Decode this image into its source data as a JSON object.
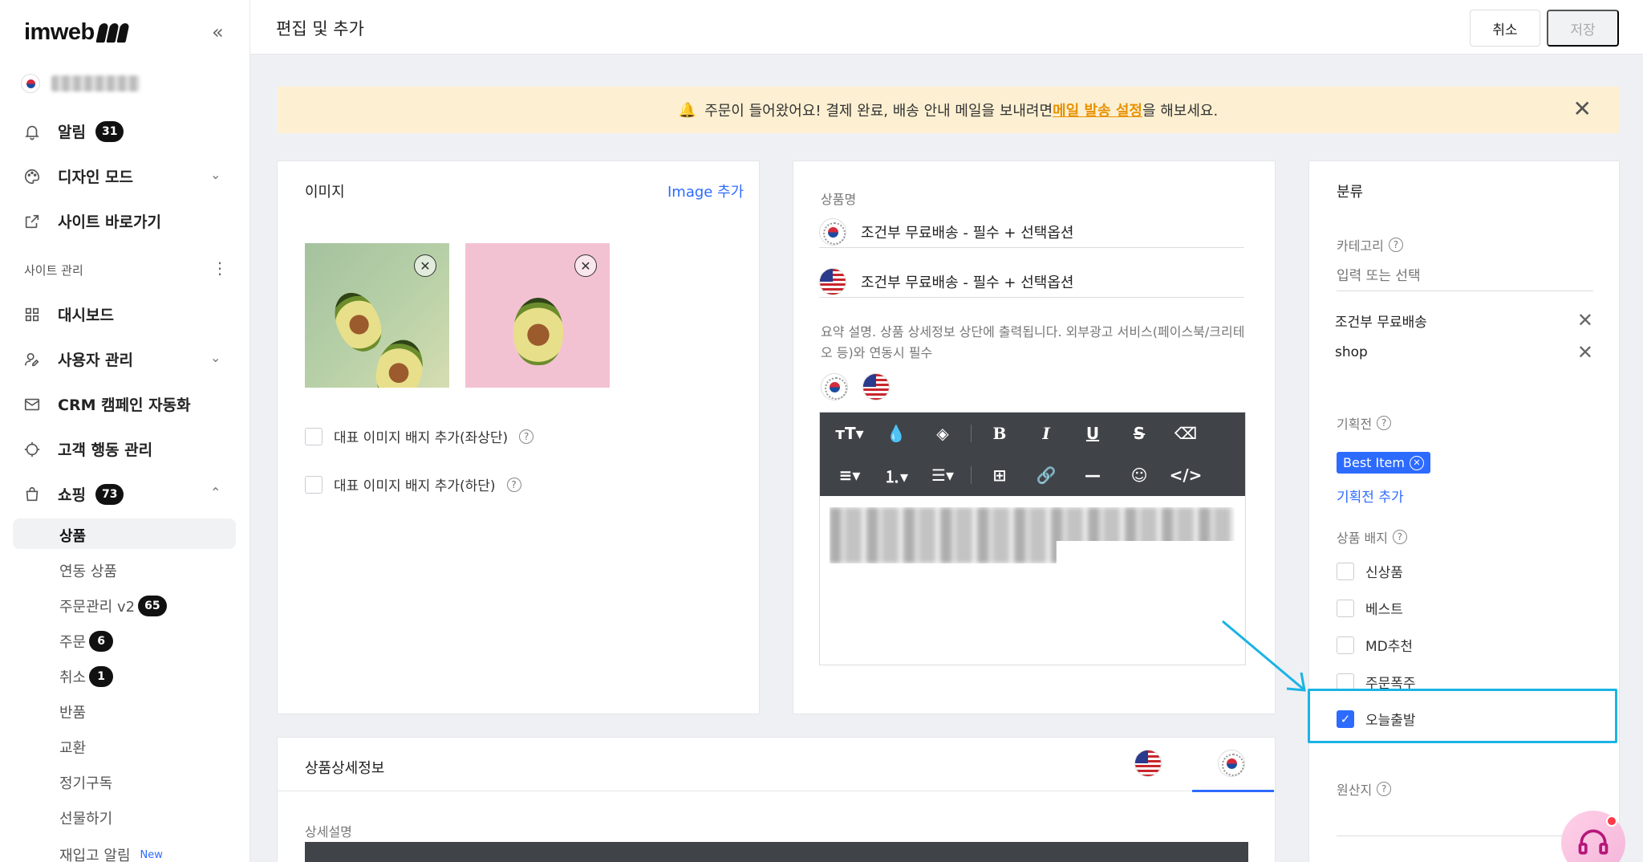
{
  "sidebar": {
    "logo": "imweb",
    "nav": [
      {
        "label": "알림",
        "badge": "31"
      },
      {
        "label": "디자인 모드"
      },
      {
        "label": "사이트 바로가기"
      }
    ],
    "section_label": "사이트 관리",
    "manage": [
      {
        "label": "대시보드"
      },
      {
        "label": "사용자 관리"
      },
      {
        "label": "CRM 캠페인 자동화"
      },
      {
        "label": "고객 행동 관리"
      },
      {
        "label": "쇼핑",
        "badge": "73"
      }
    ],
    "shopping_sub": [
      {
        "label": "상품"
      },
      {
        "label": "연동 상품"
      },
      {
        "label": "주문관리 v2",
        "badge": "65"
      },
      {
        "label": "주문",
        "badge": "6"
      },
      {
        "label": "취소",
        "badge": "1"
      },
      {
        "label": "반품"
      },
      {
        "label": "교환"
      },
      {
        "label": "정기구독"
      },
      {
        "label": "선물하기"
      },
      {
        "label": "재입고 알림",
        "tag": "New"
      }
    ]
  },
  "header": {
    "title": "편집 및 추가",
    "cancel_label": "취소",
    "save_label": "저장"
  },
  "notice": {
    "text_before": "주문이 들어왔어요! 결제 완료, 배송 안내 메일을 보내려면 ",
    "link": "메일 발송 설정",
    "text_after": "을 해보세요."
  },
  "image_card": {
    "title": "이미지",
    "add_link": "Image 추가",
    "badge_top_label": "대표 이미지 배지 추가(좌상단)",
    "badge_bottom_label": "대표 이미지 배지 추가(하단)"
  },
  "product_card": {
    "name_label": "상품명",
    "name_ko": "조건부 무료배송 - 필수 + 선택옵션",
    "name_en": "조건부 무료배송 - 필수 + 선택옵션",
    "summary_label": "요약 설명. 상품 상세정보 상단에 출력됩니다. 외부광고 서비스(페이스북/크리테오 등)와 연동시 필수"
  },
  "classify_card": {
    "title": "분류",
    "category_label": "카테고리",
    "category_placeholder": "입력 또는 선택",
    "categories": [
      "조건부 무료배송",
      "shop"
    ],
    "exhibition_label": "기획전",
    "exhibition_tag": "Best Item",
    "exhibition_add": "기획전 추가",
    "badge_label": "상품 배지",
    "badges": [
      {
        "label": "신상품",
        "checked": false
      },
      {
        "label": "베스트",
        "checked": false
      },
      {
        "label": "MD추천",
        "checked": false
      },
      {
        "label": "주문폭주",
        "checked": false
      },
      {
        "label": "오늘출발",
        "checked": true
      }
    ],
    "origin_label": "원산지"
  },
  "detail_card": {
    "title": "상품상세정보",
    "desc_label": "상세설명"
  },
  "colors": {
    "accent": "#2d6bff",
    "highlight": "#1ab3e6",
    "notice_bg": "#fdf0d2"
  }
}
